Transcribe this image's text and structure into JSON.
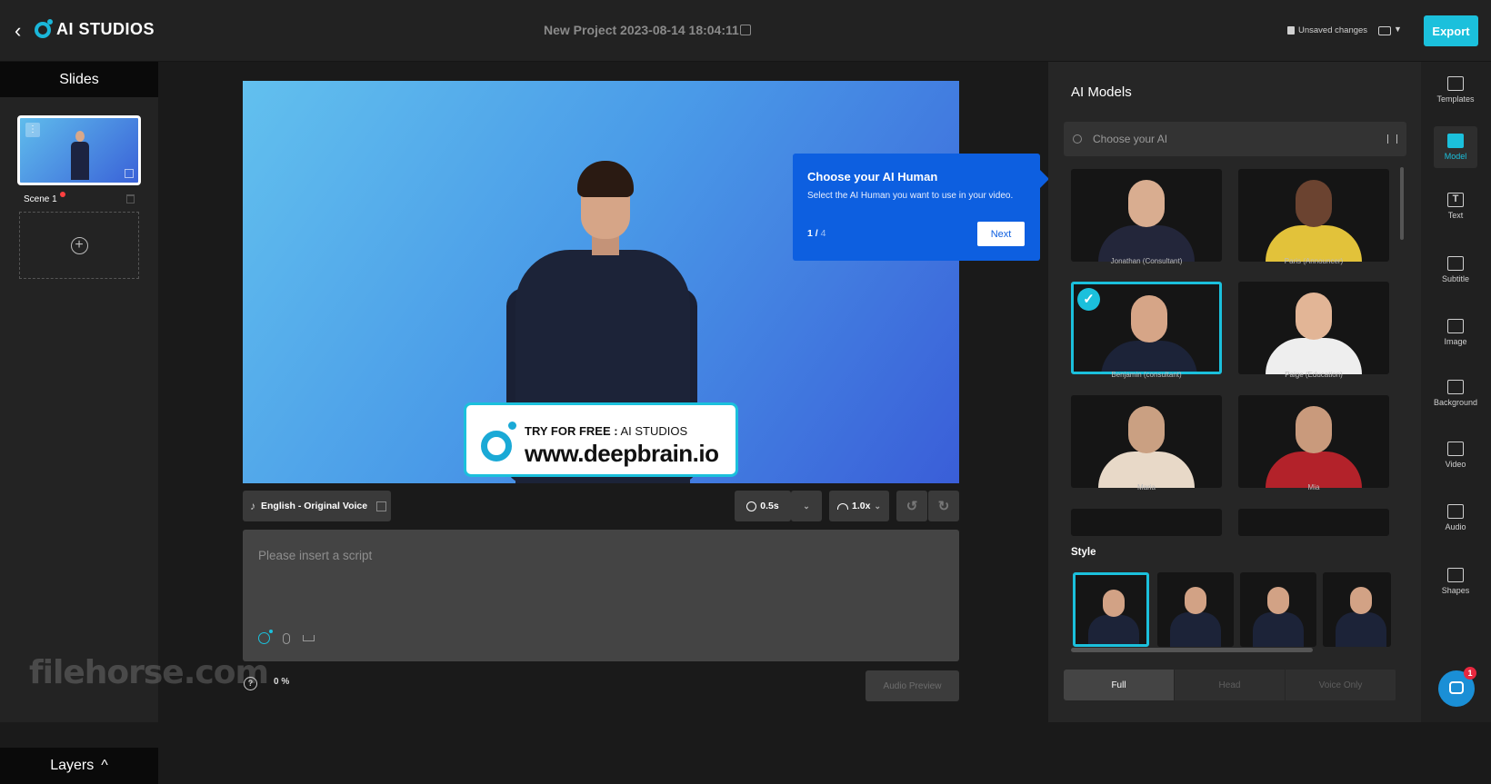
{
  "header": {
    "back_glyph": "‹",
    "logo_text": "AI STUDIOS",
    "project_title": "New Project 2023-08-14 18:04:11",
    "unsaved_label": "Unsaved changes",
    "export_label": "Export"
  },
  "slides": {
    "title": "Slides",
    "menu_glyph": "⋮",
    "scenes": [
      {
        "label": "Scene 1"
      }
    ],
    "add_glyph": "+",
    "layers_label": "Layers",
    "layers_caret": "^"
  },
  "watermark": "filehorse.com",
  "stage": {
    "promo_prefix": "TRY FOR FREE :",
    "promo_brand": "AI STUDIOS",
    "promo_url": "www.deepbrain.io"
  },
  "tooltip": {
    "title": "Choose your AI Human",
    "description": "Select the AI Human you want to use in your video.",
    "page_current": "1 /",
    "page_total": "4",
    "next_label": "Next"
  },
  "controls": {
    "voice_label": "English - Original Voice",
    "pause_value": "0.5s",
    "speed_value": "1.0x",
    "caret_glyph": "⌄",
    "undo_glyph": "↺",
    "redo_glyph": "↻",
    "script_placeholder": "Please insert a script",
    "help_glyph": "?",
    "progress": "0 %",
    "audio_preview_label": "Audio Preview"
  },
  "models": {
    "title": "AI Models",
    "search_placeholder": "Choose your AI",
    "check_glyph": "✓",
    "items": [
      {
        "name": "Jonathan (Consultant)"
      },
      {
        "name": "Paris (Announcer)"
      },
      {
        "name": "Benjamin (consultant)",
        "selected": true
      },
      {
        "name": "Paige (Education)"
      },
      {
        "name": "Maria"
      },
      {
        "name": "Mia"
      }
    ],
    "style_title": "Style",
    "segments": [
      "Full",
      "Head",
      "Voice Only"
    ],
    "active_segment": "Full"
  },
  "rail": {
    "items": [
      {
        "label": "Templates",
        "icon": "templates-icon",
        "glyph": "▦"
      },
      {
        "label": "Model",
        "icon": "model-icon",
        "glyph": "●",
        "active": true
      },
      {
        "label": "Text",
        "icon": "text-icon",
        "glyph": "T"
      },
      {
        "label": "Subtitle",
        "icon": "subtitle-icon",
        "glyph": "▭"
      },
      {
        "label": "Image",
        "icon": "image-icon",
        "glyph": "▲"
      },
      {
        "label": "Background",
        "icon": "background-icon",
        "glyph": "▨"
      },
      {
        "label": "Video",
        "icon": "video-icon",
        "glyph": "▶"
      },
      {
        "label": "Audio",
        "icon": "audio-icon",
        "glyph": "♫"
      },
      {
        "label": "Shapes",
        "icon": "shapes-icon",
        "glyph": "◇"
      }
    ]
  },
  "chat": {
    "badge_count": "1"
  },
  "colors": {
    "accent": "#1bc0dc",
    "tooltip_blue": "#0d5fe0",
    "panel": "#262626"
  }
}
